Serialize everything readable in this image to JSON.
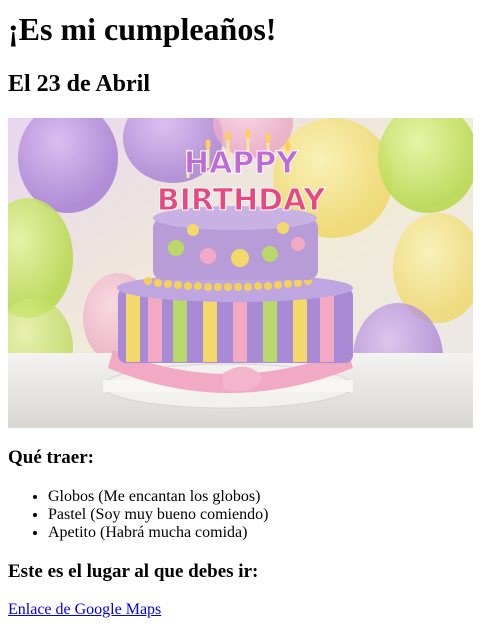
{
  "page": {
    "title": "¡Es mi cumpleaños!",
    "date": "El 23 de Abril",
    "bring_heading": "Qué traer:",
    "bring_items": [
      "Globos (Me encantan los globos)",
      "Pastel (Soy muy bueno comiendo)",
      "Apetito (Habrá mucha comida)"
    ],
    "place_heading": "Este es el lugar al que debes ir:",
    "map_link": "Enlace de Google Maps"
  },
  "image": {
    "topper_line1": "HAPPY",
    "topper_line2": "BIRTHDAY"
  },
  "colors": {
    "link": "#0000ee",
    "cake_top": "#b79cd8",
    "cake_bottom": "#a98ad6",
    "ribbon": "#f2a9c4",
    "stripe_yellow": "#f3d86a",
    "stripe_green": "#b9d86a"
  }
}
